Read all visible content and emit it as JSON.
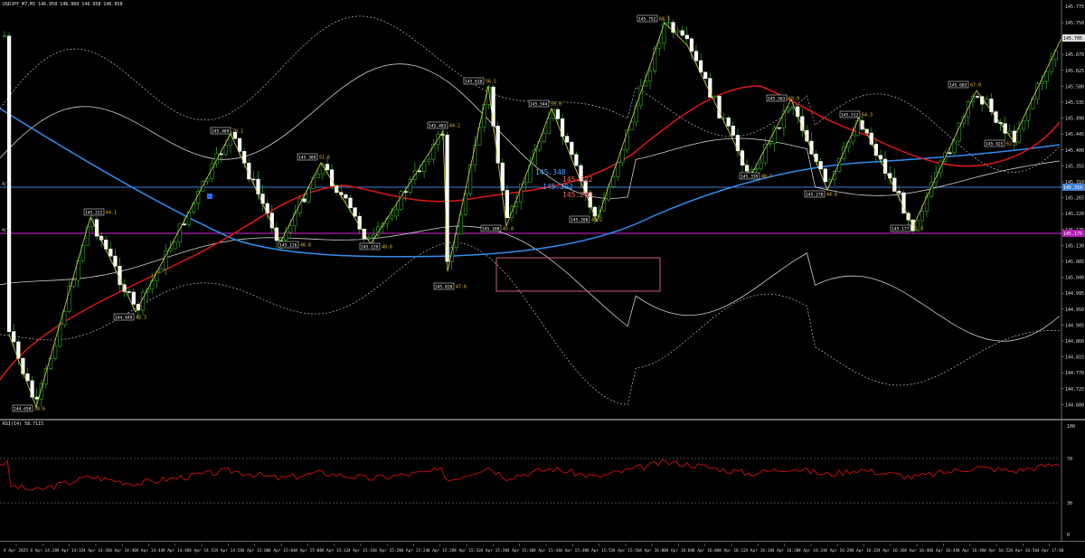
{
  "header": {
    "title": "USDJPY_M7,M1  146.958 146.960 146.958 146.958",
    "rsi_title": "RSI(14) 58.7115"
  },
  "colors": {
    "background": "#000000",
    "bull_body": "#ffffff",
    "bear_body": "#ffffff",
    "bull_wick": "#2fae2f",
    "ma_fast": "#e01818",
    "ma_slow": "#2e8ef0",
    "band_outer": "#cfcfcf",
    "band_dotted": "#bdbdbd",
    "zigzag": "#d6d64a",
    "horizontal_blue": "#3f7fd8",
    "horizontal_purple": "#b11ab1",
    "rsi_line": "#d01010",
    "label_text": "#ffffff",
    "fib_yellow": "#e8c020",
    "rect_box": "#c85a8a"
  },
  "price_axis": {
    "labels": [
      "145.750",
      "145.705",
      "145.670",
      "145.625",
      "145.580",
      "145.535",
      "145.490",
      "145.445",
      "145.400",
      "145.355",
      "145.310",
      "145.265",
      "145.220",
      "145.175",
      "145.130",
      "145.085",
      "145.040",
      "144.995",
      "144.950",
      "144.905",
      "144.860",
      "144.815",
      "144.770",
      "144.725",
      "144.680",
      "144.635"
    ],
    "top_label": "145.775",
    "current_price_marker": "145.705",
    "blue_line_marker": "145.310",
    "purple_line_marker": "145.175"
  },
  "horizontal_lines": {
    "blue_left_label": "4/4",
    "purple_left_label": "4/4"
  },
  "rsi_axis": {
    "labels": [
      "100",
      "70",
      "30",
      "0"
    ],
    "level_high": 70,
    "level_low": 30
  },
  "time_axis": {
    "labels": [
      "4 Apr 2025",
      "4 Apr 14:28",
      "4 Apr 14:32",
      "4 Apr 14:36",
      "4 Apr 14:40",
      "4 Apr 14:44",
      "4 Apr 14:48",
      "4 Apr 14:52",
      "4 Apr 14:56",
      "4 Apr 15:00",
      "4 Apr 15:04",
      "4 Apr 15:08",
      "4 Apr 15:12",
      "4 Apr 15:16",
      "4 Apr 15:20",
      "4 Apr 15:24",
      "4 Apr 15:28",
      "4 Apr 15:32",
      "4 Apr 15:36",
      "4 Apr 15:40",
      "4 Apr 15:44",
      "4 Apr 15:48",
      "4 Apr 15:52",
      "4 Apr 15:56",
      "4 Apr 16:00",
      "4 Apr 16:04",
      "4 Apr 16:08",
      "4 Apr 16:12",
      "4 Apr 16:16",
      "4 Apr 16:20",
      "4 Apr 16:24",
      "4 Apr 16:28",
      "4 Apr 16:32",
      "4 Apr 16:36",
      "4 Apr 16:40",
      "4 Apr 16:44",
      "4 Apr 16:48",
      "4 Apr 16:52",
      "4 Apr 16:56",
      "4 Apr 17:00"
    ]
  },
  "pivot_labels": [
    {
      "price": "144.650",
      "pct": "38.6"
    },
    {
      "price": "145.222",
      "pct": "64.1"
    },
    {
      "price": "144.849",
      "pct": "43.3"
    },
    {
      "price": "145.469",
      "pct": "70.2"
    },
    {
      "price": "145.126",
      "pct": "46.8"
    },
    {
      "price": "145.389",
      "pct": "51.6"
    },
    {
      "price": "145.129",
      "pct": "40.6"
    },
    {
      "price": "145.483",
      "pct": "44.2"
    },
    {
      "price": "145.018",
      "pct": "47.6"
    },
    {
      "price": "145.610",
      "pct": "56.5"
    },
    {
      "price": "145.180",
      "pct": "45.8"
    },
    {
      "price": "145.544",
      "pct": "59.0"
    },
    {
      "price": "145.208",
      "pct": "49.2"
    },
    {
      "price": "145.752",
      "pct": "68.5"
    },
    {
      "price": "145.563",
      "pct": "69.9"
    },
    {
      "price": "145.339",
      "pct": "48.7"
    },
    {
      "price": "145.512",
      "pct": "64.3"
    },
    {
      "price": "145.278",
      "pct": "44.8"
    },
    {
      "price": "145.177",
      "pct": "35.8"
    },
    {
      "price": "145.603",
      "pct": "67.0"
    },
    {
      "price": "145.425",
      "pct": "62.3"
    }
  ],
  "fib_labels": [
    "145.348",
    "145.302",
    "145.322",
    "145.278"
  ]
}
